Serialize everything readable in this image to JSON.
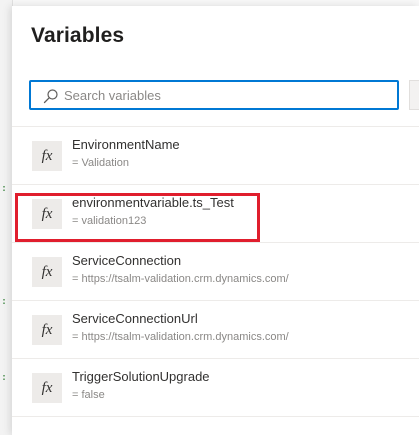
{
  "panel": {
    "title": "Variables"
  },
  "search": {
    "placeholder": "Search variables",
    "value": ""
  },
  "variables": [
    {
      "name": "EnvironmentName",
      "value": "= Validation"
    },
    {
      "name": "environmentvariable.ts_Test",
      "value": "= validation123"
    },
    {
      "name": "ServiceConnection",
      "value": "= https://tsalm-validation.crm.dynamics.com/"
    },
    {
      "name": "ServiceConnectionUrl",
      "value": "= https://tsalm-validation.crm.dynamics.com/"
    },
    {
      "name": "TriggerSolutionUpgrade",
      "value": "= false"
    }
  ],
  "icons": {
    "variable": "fx-icon",
    "search": "search-icon"
  },
  "highlight": {
    "target": "environmentvariable.ts_Test",
    "color": "#e01e2d"
  },
  "colors": {
    "accent": "#0078d4",
    "highlight": "#e01e2d"
  }
}
